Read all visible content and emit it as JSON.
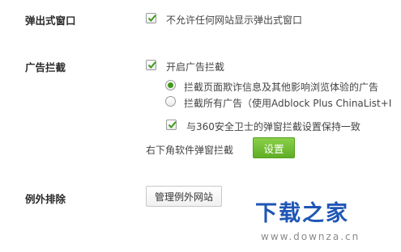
{
  "popup": {
    "section_label": "弹出式窗口",
    "block_label": "不允许任何网站显示弹出式窗口",
    "block_checked": true
  },
  "adblock": {
    "section_label": "广告拦截",
    "enable_label": "开启广告拦截",
    "enable_checked": true,
    "radio_options": [
      {
        "label": "拦截页面欺诈信息及其他影响浏览体验的广告",
        "selected": true
      },
      {
        "label": "拦截所有广告（使用Adblock Plus ChinaList+I",
        "selected": false
      }
    ],
    "sync_label": "与360安全卫士的弹窗拦截设置保持一致",
    "sync_checked": true,
    "corner_popup_label": "右下角软件弹窗拦截",
    "settings_button": "设置"
  },
  "exceptions": {
    "section_label": "例外排除",
    "manage_button": "管理例外网站"
  },
  "watermark": {
    "title": "下载之家",
    "url": "www.downza.cn"
  },
  "colors": {
    "accent_green": "#5fae25",
    "check_green": "#3f9a1a",
    "watermark_blue": "#1f56b5"
  }
}
